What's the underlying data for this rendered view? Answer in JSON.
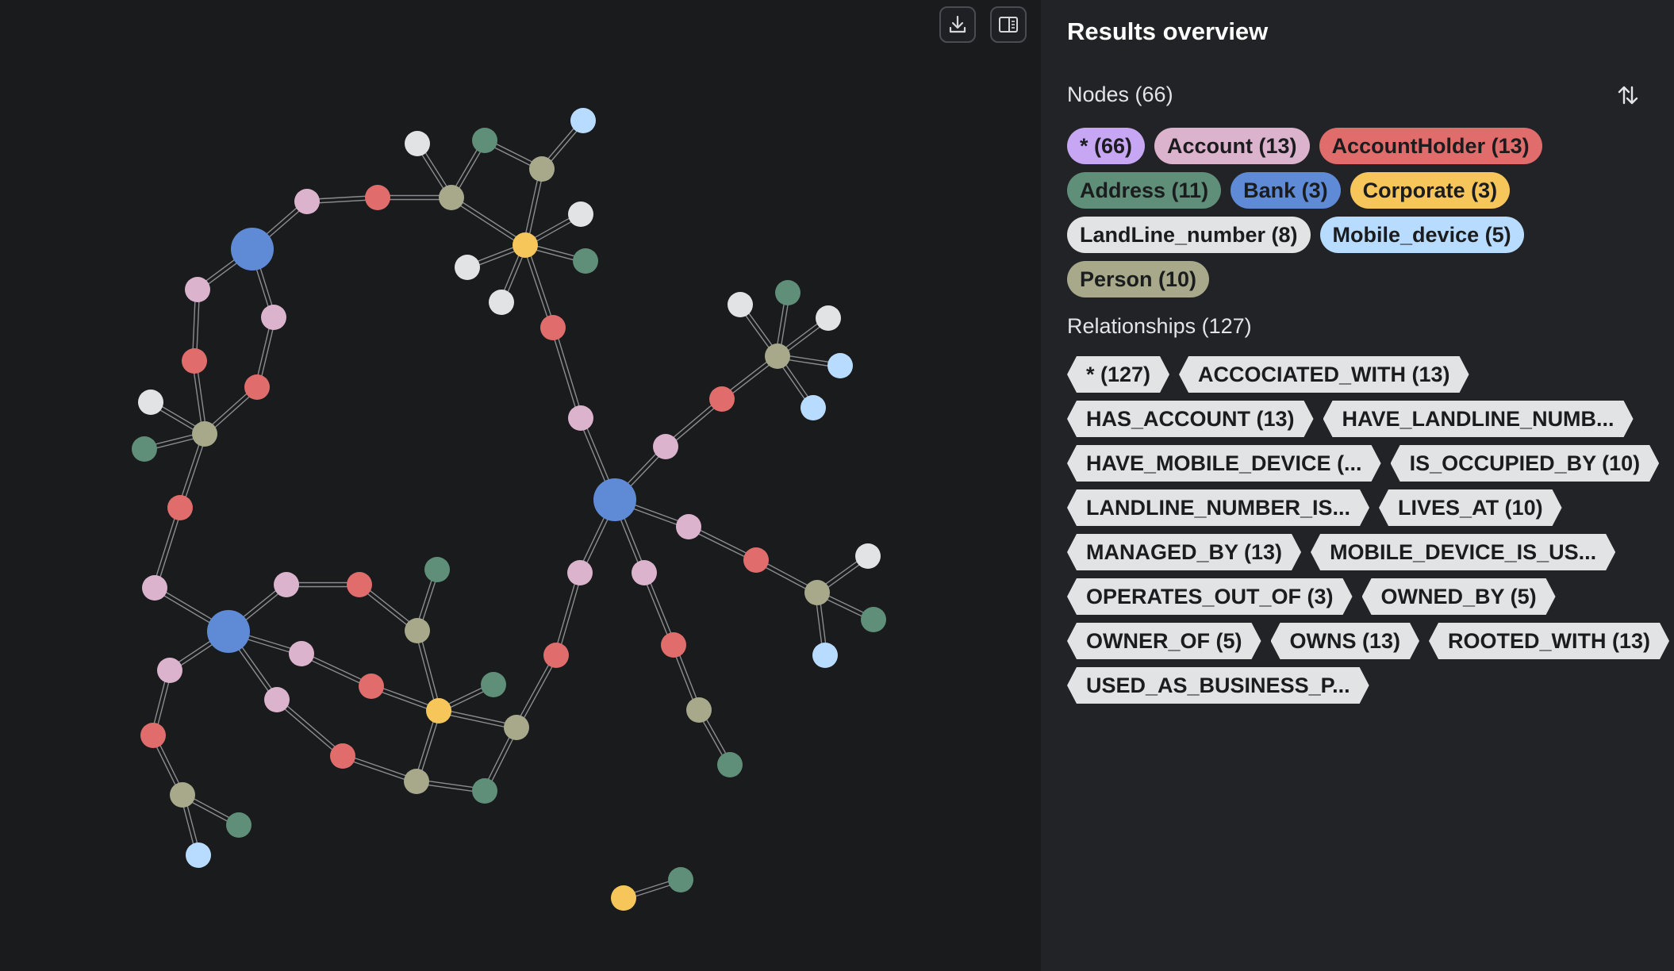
{
  "toolbar": {
    "download_icon": "download-icon",
    "panel_toggle_icon": "sidebar-panel-icon"
  },
  "panel": {
    "title": "Results overview",
    "nodes_label": "Nodes (66)",
    "relationships_label": "Relationships (127)",
    "sort_icon": "sort-arrows-icon"
  },
  "node_labels": [
    {
      "text": "* (66)",
      "color": "#c7a6f3"
    },
    {
      "text": "Account (13)",
      "color": "#dbb3cd"
    },
    {
      "text": "AccountHolder (13)",
      "color": "#e06c6c"
    },
    {
      "text": "Address (11)",
      "color": "#5f8f78"
    },
    {
      "text": "Bank (3)",
      "color": "#5e8ad6"
    },
    {
      "text": "Corporate (3)",
      "color": "#f6c65b"
    },
    {
      "text": "LandLine_number (8)",
      "color": "#e2e3e5"
    },
    {
      "text": "Mobile_device (5)",
      "color": "#b8dcff"
    },
    {
      "text": "Person (10)",
      "color": "#a8a98a"
    }
  ],
  "relationship_types": [
    "* (127)",
    "ACCOCIATED_WITH (13)",
    "HAS_ACCOUNT (13)",
    "HAVE_LANDLINE_NUMB...",
    "HAVE_MOBILE_DEVICE (...",
    "IS_OCCUPIED_BY (10)",
    "LANDLINE_NUMBER_IS...",
    "LIVES_AT (10)",
    "MANAGED_BY (13)",
    "MOBILE_DEVICE_IS_US...",
    "OPERATES_OUT_OF (3)",
    "OWNED_BY (5)",
    "OWNER_OF (5)",
    "OWNS (13)",
    "ROOTED_WITH (13)",
    "USED_AS_BUSINESS_P..."
  ],
  "colors": {
    "bank": "#5e8ad6",
    "account": "#dbb3cd",
    "account_holder": "#e06c6c",
    "person": "#a8a98a",
    "corporate": "#f6c65b",
    "address": "#5f8f78",
    "landline": "#e2e3e5",
    "mobile": "#b8dcff"
  }
}
